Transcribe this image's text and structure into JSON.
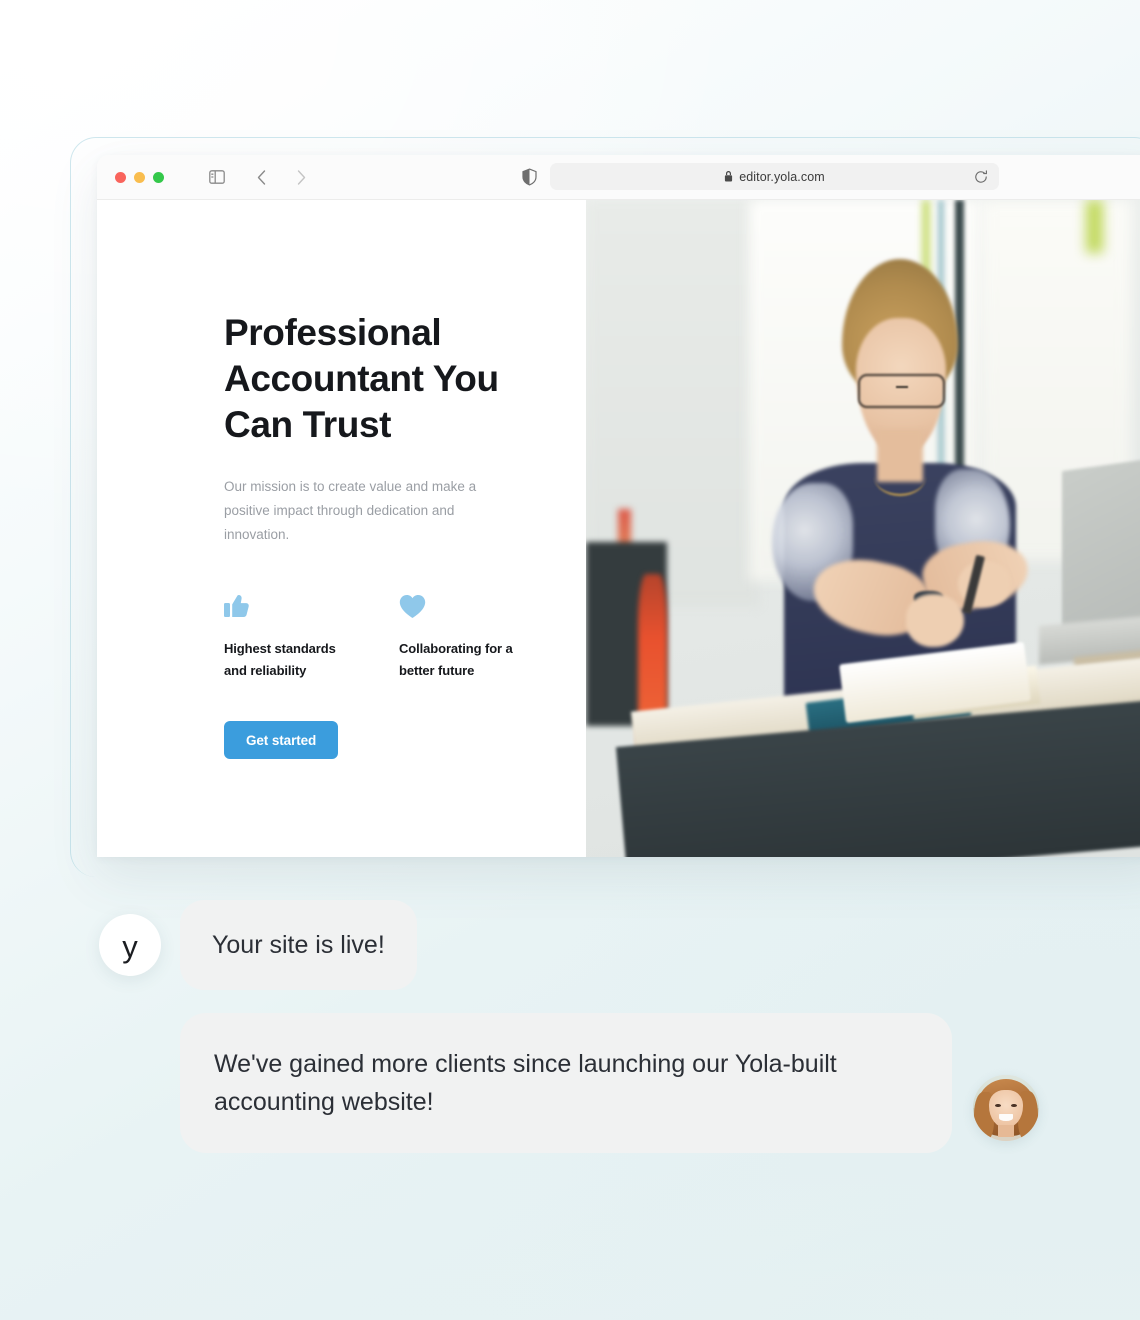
{
  "browser": {
    "url": "editor.yola.com",
    "lock_icon": "lock-icon",
    "reload_icon": "reload-icon",
    "shield_icon": "shield-icon",
    "sidebar_icon": "sidebar-toggle-icon",
    "back_icon": "chevron-left-icon",
    "forward_icon": "chevron-right-icon",
    "traffic_lights": [
      {
        "name": "close",
        "color": "#f9645c"
      },
      {
        "name": "minimize",
        "color": "#f9bd4e"
      },
      {
        "name": "zoom",
        "color": "#34c84a"
      }
    ]
  },
  "site": {
    "hero": {
      "title": "Professional Accountant You Can Trust",
      "subtitle": "Our mission is to create value and make a positive impact through dedication and innovation.",
      "cta_label": "Get started",
      "cta_color": "#3b9ddd",
      "icon_color": "#8fc8ea",
      "features": [
        {
          "icon": "thumbs-up-icon",
          "label": "Highest standards and reliability"
        },
        {
          "icon": "heart-icon",
          "label": "Collaborating for a better future"
        }
      ]
    },
    "image_alt": "Accountant working at a standing desk with notebook and laptop"
  },
  "chat": {
    "messages": [
      {
        "avatar": "yola-logo-avatar",
        "avatar_letter": "y",
        "text": "Your site is live!"
      },
      {
        "avatar": "user-photo-avatar",
        "text": "We've gained more clients since launching our Yola-built accounting website!"
      }
    ]
  },
  "theme": {
    "background_start": "#ffffff",
    "background_end": "#e2eff1",
    "bubble_bg": "#f1f2f2",
    "text_dark": "#16181c",
    "text_muted": "#9a9ea4"
  }
}
